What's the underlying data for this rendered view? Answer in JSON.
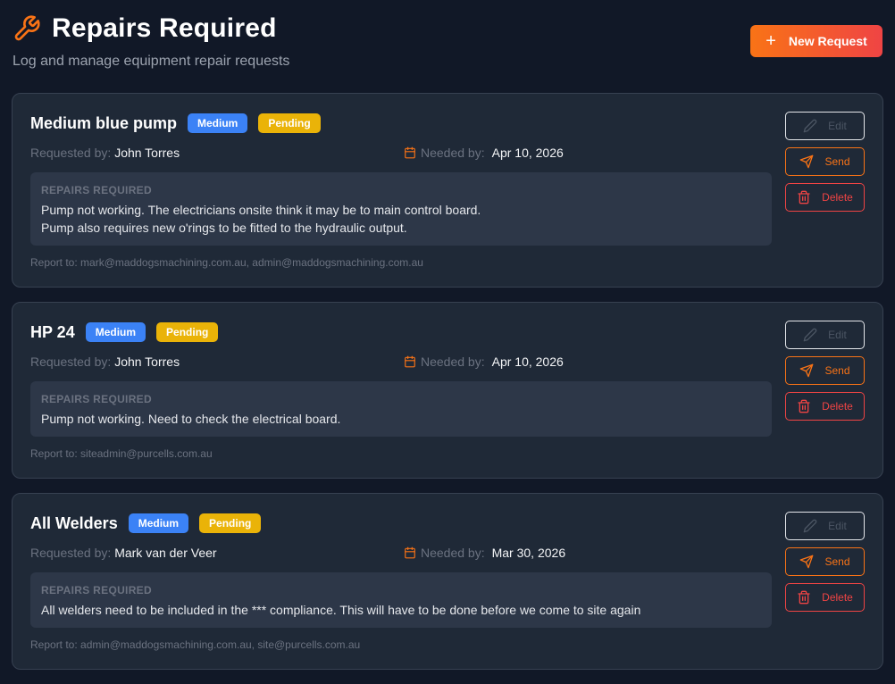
{
  "header": {
    "title": "Repairs Required",
    "subtitle": "Log and manage equipment repair requests",
    "new_request_label": "New Request"
  },
  "labels": {
    "requested_by": "Requested by:",
    "needed_by": "Needed by:",
    "repairs_required": "REPAIRS REQUIRED",
    "report_to": "Report to:",
    "edit": "Edit",
    "send": "Send",
    "delete": "Delete"
  },
  "colors": {
    "accent_orange": "#f97316",
    "accent_red": "#ef4444",
    "priority_medium": "#3b82f6",
    "status_pending": "#eab308"
  },
  "requests": [
    {
      "title": "Medium blue pump",
      "priority": "Medium",
      "status": "Pending",
      "requested_by": "John Torres",
      "needed_by": "Apr 10, 2026",
      "repairs": [
        "Pump not working. The electricians onsite think it may be to main control board.",
        "Pump also requires new o'rings to be fitted to the hydraulic output."
      ],
      "report_to": "mark@maddogsmachining.com.au, admin@maddogsmachining.com.au"
    },
    {
      "title": "HP 24",
      "priority": "Medium",
      "status": "Pending",
      "requested_by": "John Torres",
      "needed_by": "Apr 10, 2026",
      "repairs": [
        "Pump not working. Need to check the electrical board."
      ],
      "report_to": "siteadmin@purcells.com.au"
    },
    {
      "title": "All Welders",
      "priority": "Medium",
      "status": "Pending",
      "requested_by": "Mark van der Veer",
      "needed_by": "Mar 30, 2026",
      "repairs": [
        "All welders need to be included in the *** compliance. This will have to be done before we come to site again"
      ],
      "report_to": "admin@maddogsmachining.com.au, site@purcells.com.au"
    }
  ]
}
